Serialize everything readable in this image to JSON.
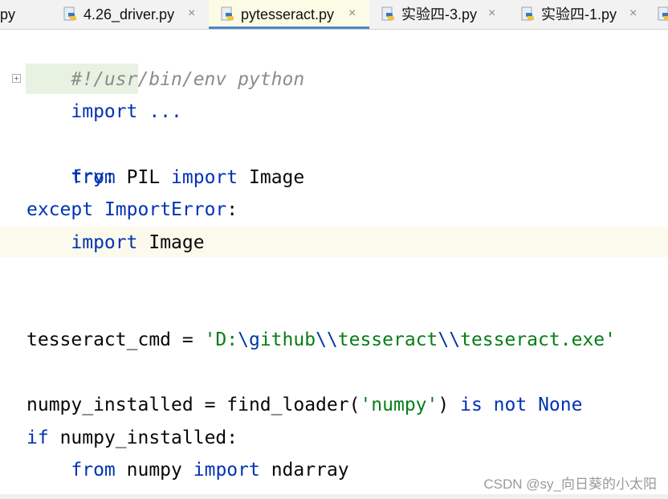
{
  "tabs": [
    {
      "label": "r.py",
      "icon": "python-file-icon",
      "active": false
    },
    {
      "label": "4.26_driver.py",
      "icon": "python-file-icon",
      "active": false
    },
    {
      "label": "pytesseract.py",
      "icon": "python-file-icon",
      "active": true
    },
    {
      "label": "实验四-3.py",
      "icon": "python-file-icon",
      "active": false
    },
    {
      "label": "实验四-1.py",
      "icon": "python-file-icon",
      "active": false
    }
  ],
  "close_glyph": "×",
  "code": {
    "shebang": "#!/usr/bin/env python",
    "import_folded": "import ...",
    "try_kw": "try",
    "colon": ":",
    "from_kw": "from",
    "import_kw": "import",
    "pil": "PIL",
    "image": "Image",
    "except_kw": "except",
    "import_error": "ImportError",
    "tesseract_var": "tesseract_cmd",
    "assign": " = ",
    "str_q1": "'D:",
    "esc1": "\\g",
    "str_mid1": "ithub",
    "esc2": "\\\\",
    "str_mid2": "tesseract",
    "esc3": "\\\\",
    "str_end": "tesseract.exe'",
    "numpy_var": "numpy_installed",
    "find_loader_call": "find_loader(",
    "numpy_str": "'numpy'",
    "close_paren": ")",
    "is_kw": "is",
    "not_kw": "not",
    "none_kw": "None",
    "if_kw": "if",
    "numpy_mod": "numpy",
    "ndarray": "ndarray"
  },
  "watermark": "CSDN @sy_向日葵的小太阳",
  "colors": {
    "keyword": "#0033b3",
    "string": "#067d17",
    "comment": "#8c8c8c",
    "active_tab_underline": "#4a88c7"
  }
}
